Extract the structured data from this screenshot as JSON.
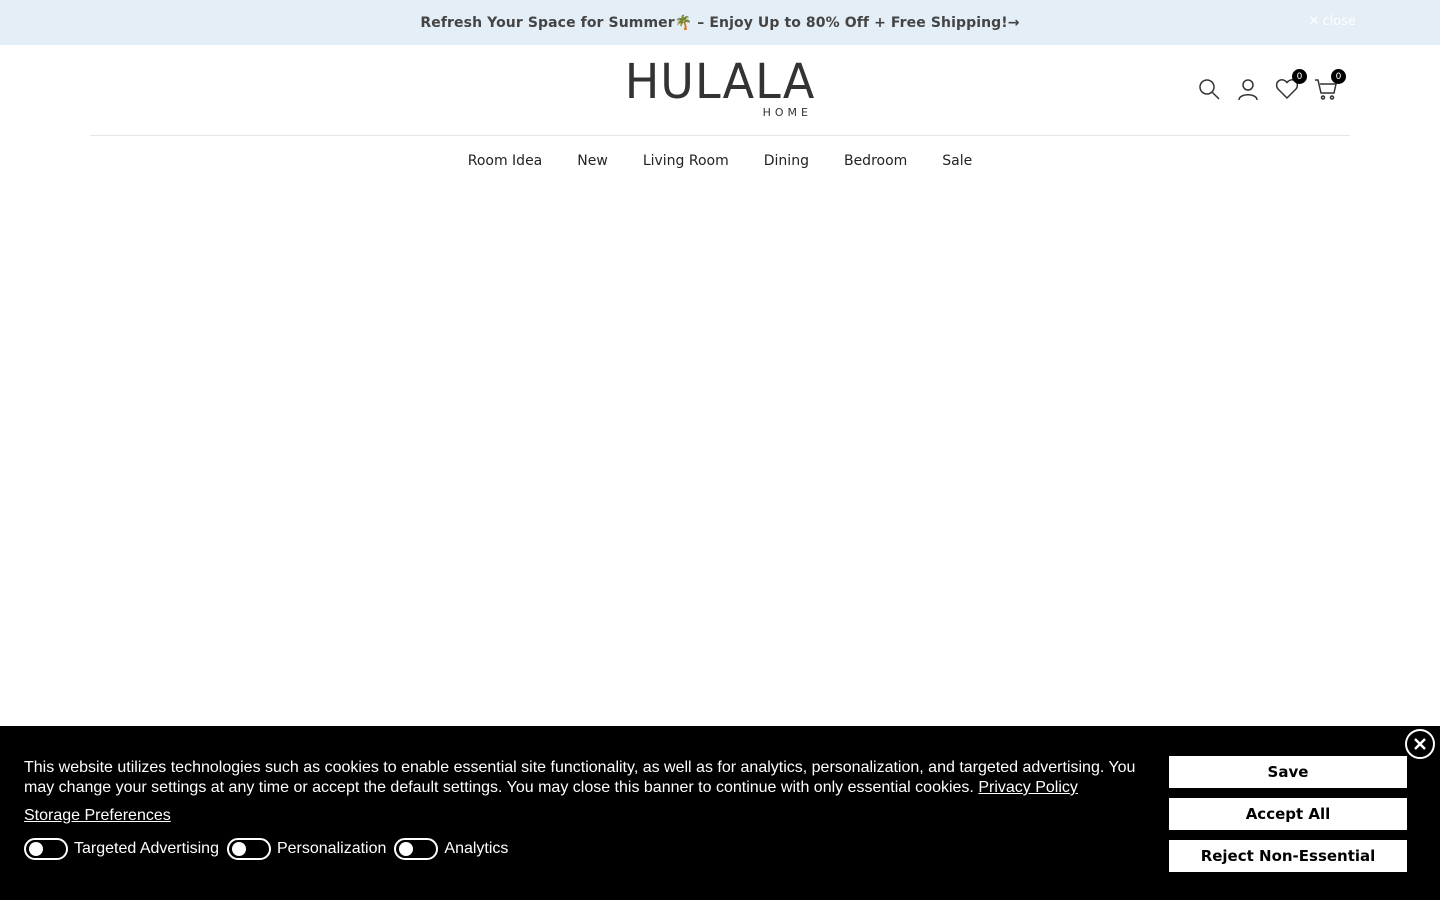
{
  "announcement": {
    "text": "Refresh Your Space for Summer🌴 – Enjoy Up to 80% Off + Free Shipping!→",
    "close_label": "close"
  },
  "header": {
    "logo_main": "HULALA",
    "logo_sub": "HOME",
    "wishlist_count": "0",
    "cart_count": "0",
    "icons": [
      "search-icon",
      "account-icon",
      "heart-icon",
      "cart-icon"
    ]
  },
  "nav": {
    "items": [
      {
        "label": "Room Idea"
      },
      {
        "label": "New"
      },
      {
        "label": "Living Room"
      },
      {
        "label": "Dining"
      },
      {
        "label": "Bedroom"
      },
      {
        "label": "Sale"
      }
    ]
  },
  "cookie": {
    "text": "This website utilizes technologies such as cookies to enable essential site functionality, as well as for analytics, personalization, and targeted advertising. You may change your settings at any time or accept the default settings. You may close this banner to continue with only essential cookies.",
    "privacy_link": "Privacy Policy",
    "storage_link": "Storage Preferences",
    "toggles": [
      {
        "label": "Targeted Advertising",
        "on": false
      },
      {
        "label": "Personalization",
        "on": false
      },
      {
        "label": "Analytics",
        "on": false
      }
    ],
    "buttons": {
      "save": "Save",
      "accept": "Accept All",
      "reject": "Reject Non-Essential"
    }
  },
  "colors": {
    "announcement_bg": "#e4eef6",
    "banner_bg": "#000000",
    "button_bg": "#ffffff"
  }
}
